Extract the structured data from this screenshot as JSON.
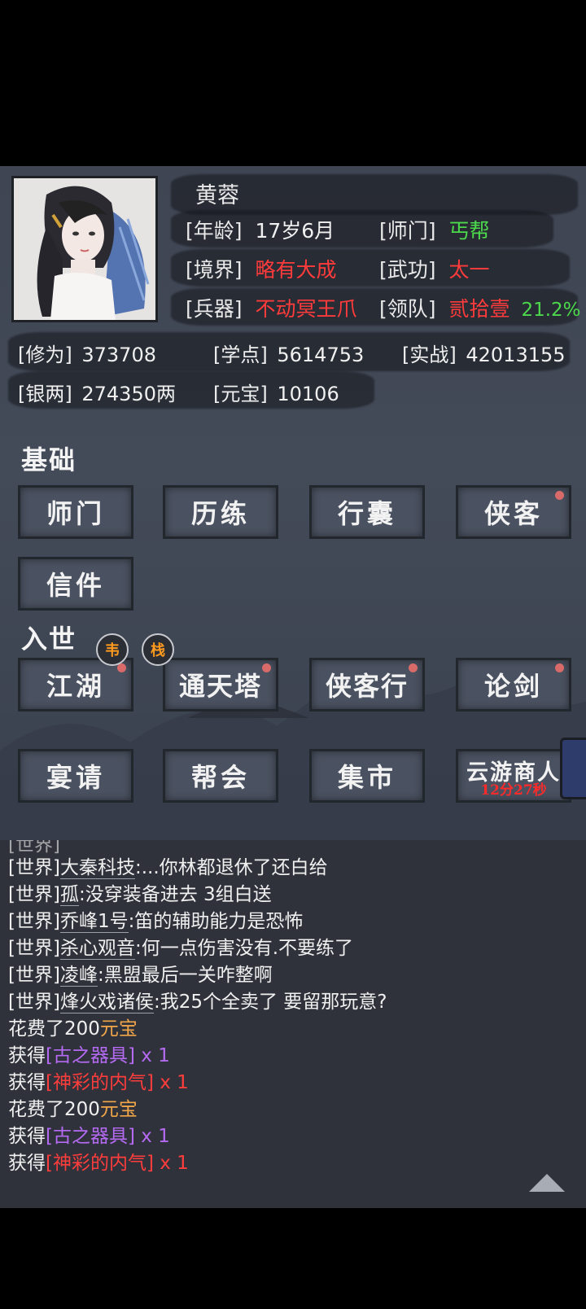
{
  "profile": {
    "name": "黄蓉",
    "age_label": "[年龄]",
    "age": "17岁6月",
    "sect_label": "[师门]",
    "sect": "丐帮",
    "realm_label": "[境界]",
    "realm": "略有大成",
    "skill_label": "[武功]",
    "skill": "太一",
    "weapon_label": "[兵器]",
    "weapon": "不动冥王爪",
    "team_label": "[领队]",
    "team": "贰拾壹",
    "team_pct": "21.2%"
  },
  "stats": {
    "cultivation_label": "[修为]",
    "cultivation": "373708",
    "study_label": "[学点]",
    "study": "5614753",
    "combat_label": "[实战]",
    "combat": "42013155",
    "silver_label": "[银两]",
    "silver": "274350两",
    "yuanbao_label": "[元宝]",
    "yuanbao": "10106"
  },
  "basic": {
    "title": "基础",
    "buttons": [
      "师门",
      "历练",
      "行囊",
      "侠客",
      "信件"
    ]
  },
  "world": {
    "title": "入世",
    "medals": [
      "韦",
      "栈"
    ],
    "buttons": [
      "江湖",
      "通天塔",
      "侠客行",
      "论剑",
      "宴请",
      "帮会",
      "集市",
      "云游商人"
    ],
    "merchant_timer": "12分27秒"
  },
  "chat": {
    "lines": [
      {
        "channel": "[世界]",
        "who": "大秦科技",
        "msg": ":...你林都退休了还白给"
      },
      {
        "channel": "[世界]",
        "who": "孤",
        "msg": ":没穿装备进去 3组白送"
      },
      {
        "channel": "[世界]",
        "who": "乔峰1号",
        "msg": ":笛的辅助能力是恐怖"
      },
      {
        "channel": "[世界]",
        "who": "杀心观音",
        "msg": ":何一点伤害没有.不要练了"
      },
      {
        "channel": "[世界]",
        "who": "凌峰",
        "msg": ":黑盟最后一关咋整啊"
      },
      {
        "channel": "[世界]",
        "who": "烽火戏诸侯",
        "msg": ":我25个全卖了  要留那玩意?"
      }
    ],
    "spend1_pre": "花费了200",
    "spend1_unit": "元宝",
    "gain_pre": "获得",
    "item1": "[古之器具]",
    "item1_qty": " x 1",
    "item2": "[神彩的内气]",
    "item2_qty": " x 1",
    "spend2_pre": "花费了200",
    "spend2_unit": "元宝",
    "item3": "[古之器具]",
    "item3_qty": " x 1",
    "item4": "[神彩的内气]",
    "item4_qty": " x 1"
  },
  "colors": {
    "red": "#ff3b3b",
    "green": "#4cd94c",
    "gold": "#f2a64a",
    "purple": "#b46af2"
  }
}
